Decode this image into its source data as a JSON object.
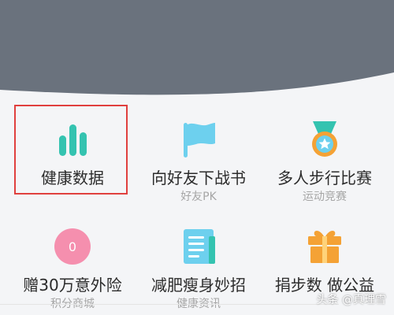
{
  "colors": {
    "header_background": "#6a727d",
    "page_background": "#f4f5f7",
    "highlight_border": "#e0403e",
    "teal": "#34c3b0",
    "sky_blue": "#6dd0ee",
    "orange": "#f4a235",
    "pink": "#f58fae"
  },
  "menu": {
    "items": [
      {
        "title": "健康数据",
        "subtitle": "",
        "icon": "bar-chart-icon"
      },
      {
        "title": "向好友下战书",
        "subtitle": "好友PK",
        "icon": "flag-icon"
      },
      {
        "title": "多人步行比赛",
        "subtitle": "运动竞赛",
        "icon": "medal-icon"
      },
      {
        "title": "赠30万意外险",
        "subtitle": "积分商城",
        "icon": "coin-icon",
        "icon_text": "0"
      },
      {
        "title": "减肥瘦身妙招",
        "subtitle": "健康资讯",
        "icon": "document-icon"
      },
      {
        "title": "捐步数 做公益",
        "subtitle": "",
        "icon": "gift-icon"
      }
    ]
  },
  "watermark": {
    "text": "头条 @真理雪"
  }
}
